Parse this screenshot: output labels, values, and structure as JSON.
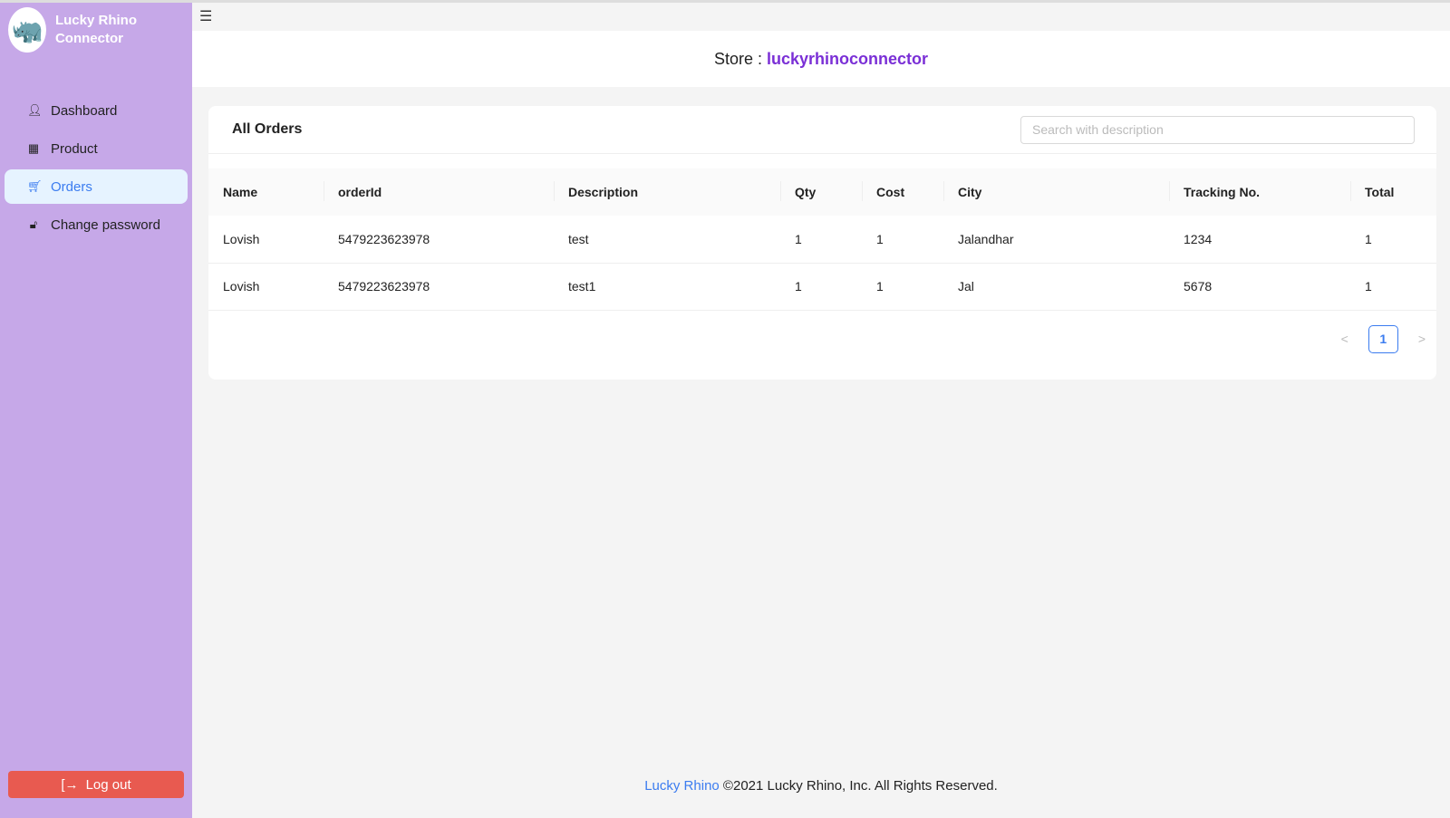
{
  "app": {
    "name": "Lucky Rhino Connector"
  },
  "sidebar": {
    "items": [
      {
        "label": "Dashboard",
        "icon": "user-icon",
        "active": false
      },
      {
        "label": "Product",
        "icon": "shop-icon",
        "active": false
      },
      {
        "label": "Orders",
        "icon": "cart-icon",
        "active": true
      },
      {
        "label": "Change password",
        "icon": "lock-icon",
        "active": false
      }
    ],
    "logout": "Log out"
  },
  "header": {
    "prefix": "Store :",
    "store": "luckyrhinoconnector"
  },
  "orders": {
    "title": "All Orders",
    "search_placeholder": "Search with description",
    "columns": [
      "Name",
      "orderId",
      "Description",
      "Qty",
      "Cost",
      "City",
      "Tracking No.",
      "Total"
    ],
    "rows": [
      [
        "Lovish",
        "5479223623978",
        "test",
        "1",
        "1",
        "Jalandhar",
        "1234",
        "1"
      ],
      [
        "Lovish",
        "5479223623978",
        "test1",
        "1",
        "1",
        "Jal",
        "5678",
        "1"
      ]
    ],
    "page": "1"
  },
  "footer": {
    "brand": "Lucky Rhino",
    "text": "©2021 Lucky Rhino, Inc. All Rights Reserved."
  },
  "colors": {
    "sidebar": "#c6a8e8",
    "accent": "#3b7cf0",
    "store": "#7a2fd6",
    "logout": "#e85a50"
  }
}
